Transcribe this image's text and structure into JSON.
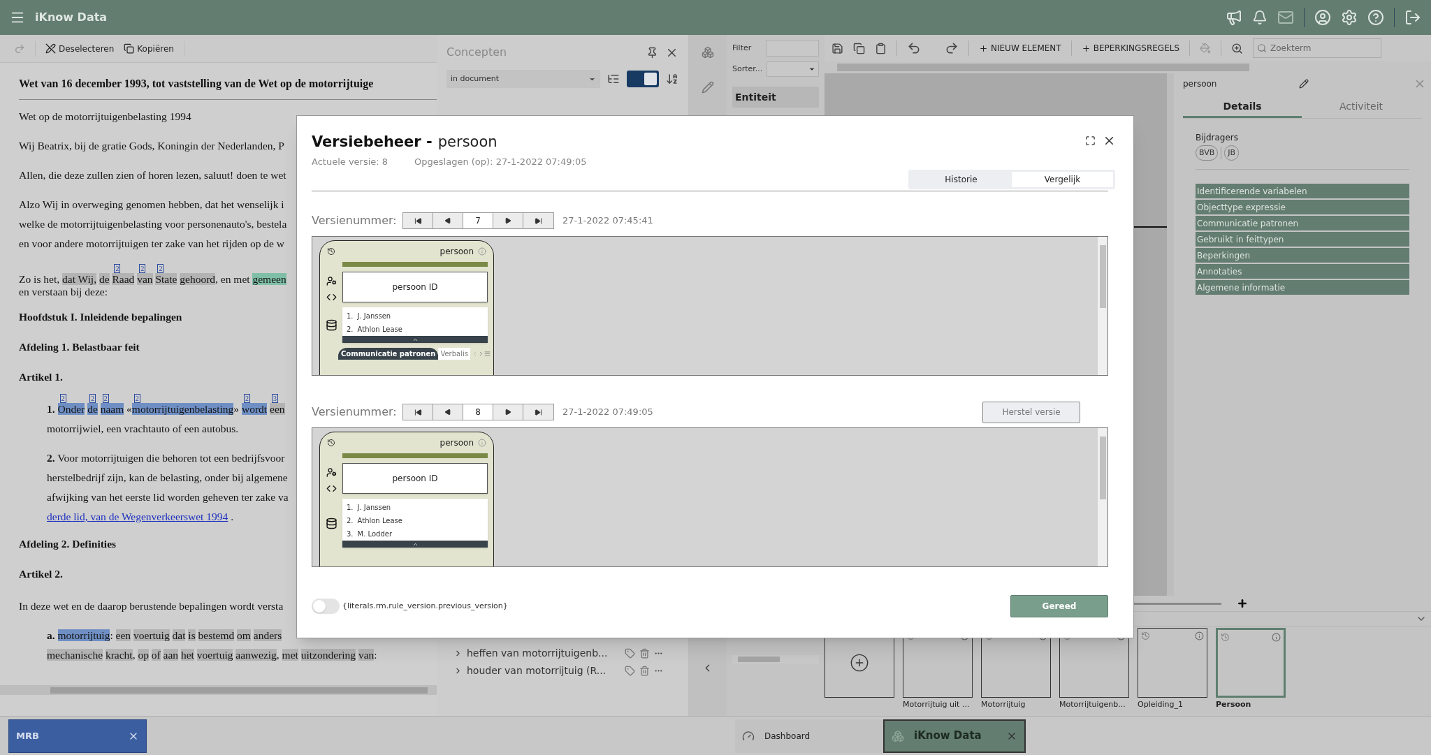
{
  "app": {
    "title": "iKnow Data"
  },
  "doc_toolbar": {
    "buttons": [
      {
        "kind": "deselect",
        "label": "Deselecteren"
      },
      {
        "kind": "copy",
        "label": "Kopiëren"
      }
    ]
  },
  "document": {
    "title": "Wet van 16 december 1993, tot vaststelling van de Wet op de motorrijtuige",
    "blocks": [
      {
        "kind": "para",
        "lines": [
          [
            {
              "t": "Wet op de motorrijtuigenbelasting 1994"
            }
          ]
        ]
      },
      {
        "kind": "para",
        "lines": [
          [
            {
              "t": "Wij Beatrix, bij de gratie Gods, Koningin der Nederlanden, P"
            }
          ]
        ]
      },
      {
        "kind": "para",
        "lines": [
          [
            {
              "t": "Allen, die deze zullen zien of horen lezen, saluut! doen te wet"
            }
          ]
        ]
      },
      {
        "kind": "para",
        "lines": [
          [
            {
              "t": "Alzo Wij in overweging genomen hebben, dat het wenselijk i"
            }
          ],
          [
            {
              "t": "welke de motorrijtuigenbelasting voor personenauto's, bestela"
            }
          ],
          [
            {
              "t": "en voor andere motorrijtuigen ter zake van het rijden op de w"
            }
          ]
        ]
      },
      {
        "kind": "tight",
        "lines": [
          [
            {
              "t": "Zo is het, "
            },
            {
              "t": "dat Wij, ",
              "color": "#b3b3b3"
            },
            {
              "t": "de ",
              "color": "#b3b3b3"
            },
            {
              "t": "Raad ",
              "color": "#b3b3b3",
              "ref": "2"
            },
            {
              "t": "van ",
              "color": "#b3b3b3",
              "ref": "2"
            },
            {
              "t": "State ",
              "color": "#b3b3b3",
              "ref": "2"
            },
            {
              "t": "gehoord",
              "color": "#b3b3b3"
            },
            {
              "t": ", en met "
            },
            {
              "t": "gemeen",
              "color": "#7fbfa8"
            }
          ],
          [
            {
              "t": "en verstaan bij deze:"
            }
          ]
        ]
      },
      {
        "kind": "heading",
        "lines": [
          [
            {
              "t": "Hoofdstuk I. Inleidende bepalingen"
            }
          ]
        ]
      },
      {
        "kind": "heading",
        "lines": [
          [
            {
              "t": "Afdeling 1. Belastbaar feit"
            }
          ]
        ]
      },
      {
        "kind": "heading",
        "lines": [
          [
            {
              "t": "Artikel 1."
            }
          ]
        ]
      },
      {
        "kind": "indent",
        "lines": [
          [
            {
              "t": "**1.** "
            },
            {
              "t": "Onder ",
              "color": "#6f8fc4",
              "ref": "2"
            },
            {
              "t": "de ",
              "color": "#6f8fc4",
              "ref": "2"
            },
            {
              "t": "naam",
              "color": "#6f8fc4",
              "ref": "2"
            },
            {
              "t": " «"
            },
            {
              "t": "motorrijtuigenbelasting",
              "color": "#6f8fc4",
              "ref": "2"
            },
            {
              "t": "» "
            },
            {
              "t": "wordt ",
              "color": "#6f8fc4",
              "ref": "2"
            },
            {
              "t": "een",
              "color": "#b3b3b3",
              "ref": "3"
            }
          ],
          [
            {
              "t": "motorrijwiel, een vrachtauto of een autobus."
            }
          ]
        ]
      },
      {
        "kind": "indent",
        "lines": [
          [
            {
              "t": "**2.** Voor motorrijtuigen die behoren tot een bedrijfsvoor"
            }
          ],
          [
            {
              "t": "herstelbedrijf zijn, kan de belasting, onder bij algemene"
            }
          ],
          [
            {
              "t": "afwijking van het eerste lid worden geheven ter zake va"
            }
          ],
          [
            {
              "t": "derde lid, van de Wegenverkeerswet 1994",
              "kind": "link"
            },
            {
              "t": " ."
            }
          ]
        ]
      },
      {
        "kind": "heading",
        "lines": [
          [
            {
              "t": "Afdeling 2. Definities"
            }
          ]
        ]
      },
      {
        "kind": "heading",
        "lines": [
          [
            {
              "t": "Artikel 2."
            }
          ]
        ]
      },
      {
        "kind": "para",
        "lines": [
          [
            {
              "t": "In deze wet en de daarop berustende bepalingen wordt versta"
            }
          ]
        ]
      },
      {
        "kind": "indent",
        "lines": [
          [
            {
              "t": "**a.** "
            },
            {
              "t": "motorrijtuig",
              "color": "#6f8fc4"
            },
            {
              "t": ": "
            },
            {
              "t": "een ",
              "color": "#b3b3b3"
            },
            {
              "t": "voertuig ",
              "color": "#b3b3b3"
            },
            {
              "t": "dat ",
              "color": "#b3b3b3"
            },
            {
              "t": "is ",
              "color": "#b3b3b3"
            },
            {
              "t": "bestemd ",
              "color": "#b3b3b3"
            },
            {
              "t": "om ",
              "color": "#b3b3b3"
            },
            {
              "t": "anders",
              "color": "#b3b3b3"
            }
          ],
          [
            {
              "t": "mechanische ",
              "color": "#b3b3b3"
            },
            {
              "t": "kracht",
              "color": "#b3b3b3"
            },
            {
              "t": ", "
            },
            {
              "t": "op ",
              "color": "#b3b3b3"
            },
            {
              "t": "of ",
              "color": "#b3b3b3"
            },
            {
              "t": "aan ",
              "color": "#b3b3b3"
            },
            {
              "t": "het ",
              "color": "#b3b3b3"
            },
            {
              "t": "voertuig ",
              "color": "#b3b3b3"
            },
            {
              "t": "aanwezig",
              "color": "#b3b3b3"
            },
            {
              "t": ", "
            },
            {
              "t": "met ",
              "color": "#b3b3b3"
            },
            {
              "t": "uitzondering ",
              "color": "#b3b3b3"
            },
            {
              "t": "van",
              "color": "#b3b3b3"
            },
            {
              "t": ":"
            }
          ]
        ]
      }
    ]
  },
  "concepts": {
    "title": "Concepten",
    "scope": "in document",
    "toggle_on": true,
    "items": [
      {
        "label": "heffen van motorrijtuigenb..."
      },
      {
        "label": "houder van motorrijtuig (R..."
      }
    ]
  },
  "filter": {
    "filter_label": "Filter",
    "sort_label": "Sorter...",
    "panel_title": "Entiteit"
  },
  "canvas_toolbar": {
    "buttons": [
      {
        "label": "NIEUW ELEMENT"
      },
      {
        "label": "BEPERKINGSREGELS"
      }
    ],
    "search_placeholder": "Zoekterm"
  },
  "details": {
    "title": "persoon",
    "tabs": [
      {
        "label": "Details",
        "selected": true
      },
      {
        "label": "Activiteit",
        "selected": false
      }
    ],
    "contributors_label": "Bijdragers",
    "contributors": [
      "BVB",
      "JB"
    ],
    "sections": [
      "Identificerende variabelen",
      "Objecttype expressie",
      "Communicatie patronen",
      "Gebruikt in feittypen",
      "Beperkingen",
      "Annotaties",
      "Algemene informatie"
    ]
  },
  "thumbnails": [
    {
      "label": "Motorrijtuig uit ...",
      "selected": false
    },
    {
      "label": "Motorrijtuig",
      "selected": false
    },
    {
      "label": "Motorrijtuigenb...",
      "selected": false
    },
    {
      "label": "Opleiding_1",
      "selected": false
    },
    {
      "label": "Persoon",
      "selected": true
    }
  ],
  "taskbar": {
    "left_tabs": [
      {
        "label": "MRB"
      }
    ],
    "tabs": [
      {
        "kind": "dashboard",
        "label": "Dashboard",
        "selected": false
      },
      {
        "kind": "app",
        "label": "iKnow Data",
        "selected": true
      }
    ]
  },
  "modal": {
    "title": "Versiebeheer -",
    "subject": "persoon",
    "current_version": "Actuele versie: 8",
    "saved": "Opgeslagen (op): 27-1-2022 07:49:05",
    "tabs": [
      {
        "label": "Historie",
        "selected": false
      },
      {
        "label": "Vergelijk",
        "selected": true
      }
    ],
    "versions": [
      {
        "label": "Versienummer:",
        "number": "7",
        "date": "27-1-2022 07:45:41",
        "card": {
          "name": "persoon",
          "identifier": "persoon ID",
          "values": [
            {
              "number": "1.",
              "text": "J. Janssen"
            },
            {
              "number": "2.",
              "text": "Athlon Lease"
            }
          ],
          "tabs": [
            "Communicatie patronen",
            "Verbalis"
          ]
        }
      },
      {
        "label": "Versienummer:",
        "number": "8",
        "date": "27-1-2022 07:49:05",
        "restore": {
          "label": "Herstel versie",
          "disabled": true
        },
        "card": {
          "name": "persoon",
          "identifier": "persoon ID",
          "values": [
            {
              "number": "1.",
              "text": "J. Janssen"
            },
            {
              "number": "2.",
              "text": "Athlon Lease"
            },
            {
              "number": "3.",
              "text": "M. Lodder"
            }
          ]
        }
      }
    ],
    "toggle": {
      "label": "{literals.rm.rule_version.previous_version}",
      "on": false
    },
    "done_button": "Gereed"
  }
}
